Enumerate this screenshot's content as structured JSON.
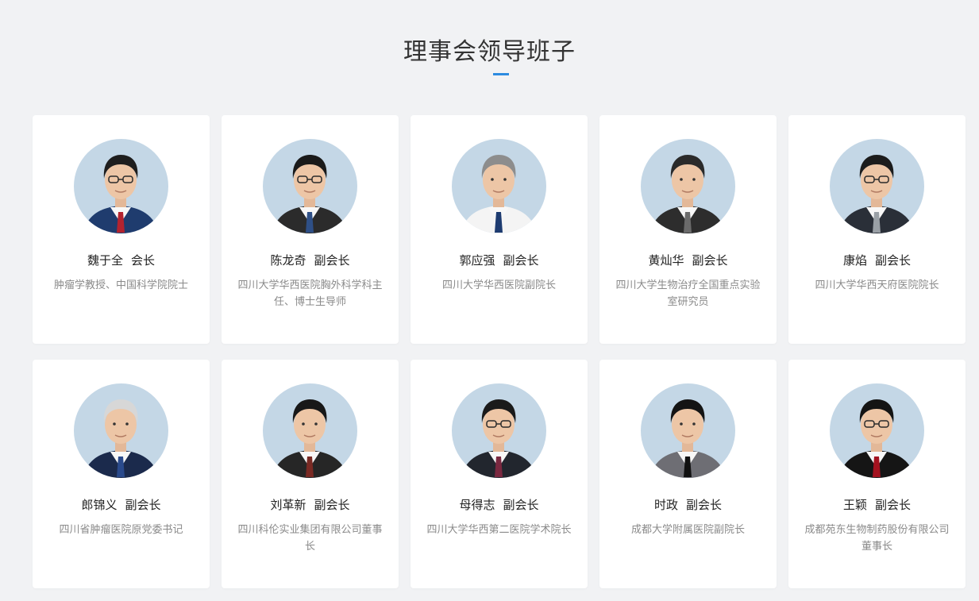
{
  "section": {
    "title": "理事会领导班子"
  },
  "members": [
    {
      "name": "魏于全",
      "role": "会长",
      "desc": "肿瘤学教授、中国科学院院士",
      "hair": "#1e1e1e",
      "suit": "#1f3c6e",
      "tie": "#b3232f",
      "glasses": true
    },
    {
      "name": "陈龙奇",
      "role": "副会长",
      "desc": "四川大学华西医院胸外科学科主任、博士生导师",
      "hair": "#1a1a1a",
      "suit": "#2b2b2b",
      "tie": "#2e4f86",
      "glasses": true
    },
    {
      "name": "郭应强",
      "role": "副会长",
      "desc": "四川大学华西医院副院长",
      "hair": "#8d8d8d",
      "suit": "#f4f4f4",
      "tie": "#1d3b70",
      "glasses": false
    },
    {
      "name": "黄灿华",
      "role": "副会长",
      "desc": "四川大学生物治疗全国重点实验室研究员",
      "hair": "#2a2a2a",
      "suit": "#2d2d2d",
      "tie": "#6b6b6b",
      "glasses": false
    },
    {
      "name": "康焰",
      "role": "副会长",
      "desc": "四川大学华西天府医院院长",
      "hair": "#1c1c1c",
      "suit": "#2a2f38",
      "tie": "#9aa0a6",
      "glasses": true
    },
    {
      "name": "郎锦义",
      "role": "副会长",
      "desc": "四川省肿瘤医院原党委书记",
      "hair": "#d7d7d7",
      "suit": "#1b2a4c",
      "tie": "#2a4a8c",
      "glasses": false
    },
    {
      "name": "刘革新",
      "role": "副会长",
      "desc": "四川科伦实业集团有限公司董事长",
      "hair": "#181818",
      "suit": "#262626",
      "tie": "#7a2a24",
      "glasses": false
    },
    {
      "name": "母得志",
      "role": "副会长",
      "desc": "四川大学华西第二医院学术院长",
      "hair": "#1a1a1a",
      "suit": "#22262e",
      "tie": "#7a2840",
      "glasses": true
    },
    {
      "name": "时政",
      "role": "副会长",
      "desc": "成都大学附属医院副院长",
      "hair": "#141414",
      "suit": "#6e6e74",
      "tie": "#111111",
      "glasses": false
    },
    {
      "name": "王颖",
      "role": "副会长",
      "desc": "成都苑东生物制药股份有限公司董事长",
      "hair": "#141414",
      "suit": "#151515",
      "tie": "#a3121f",
      "glasses": true
    }
  ]
}
